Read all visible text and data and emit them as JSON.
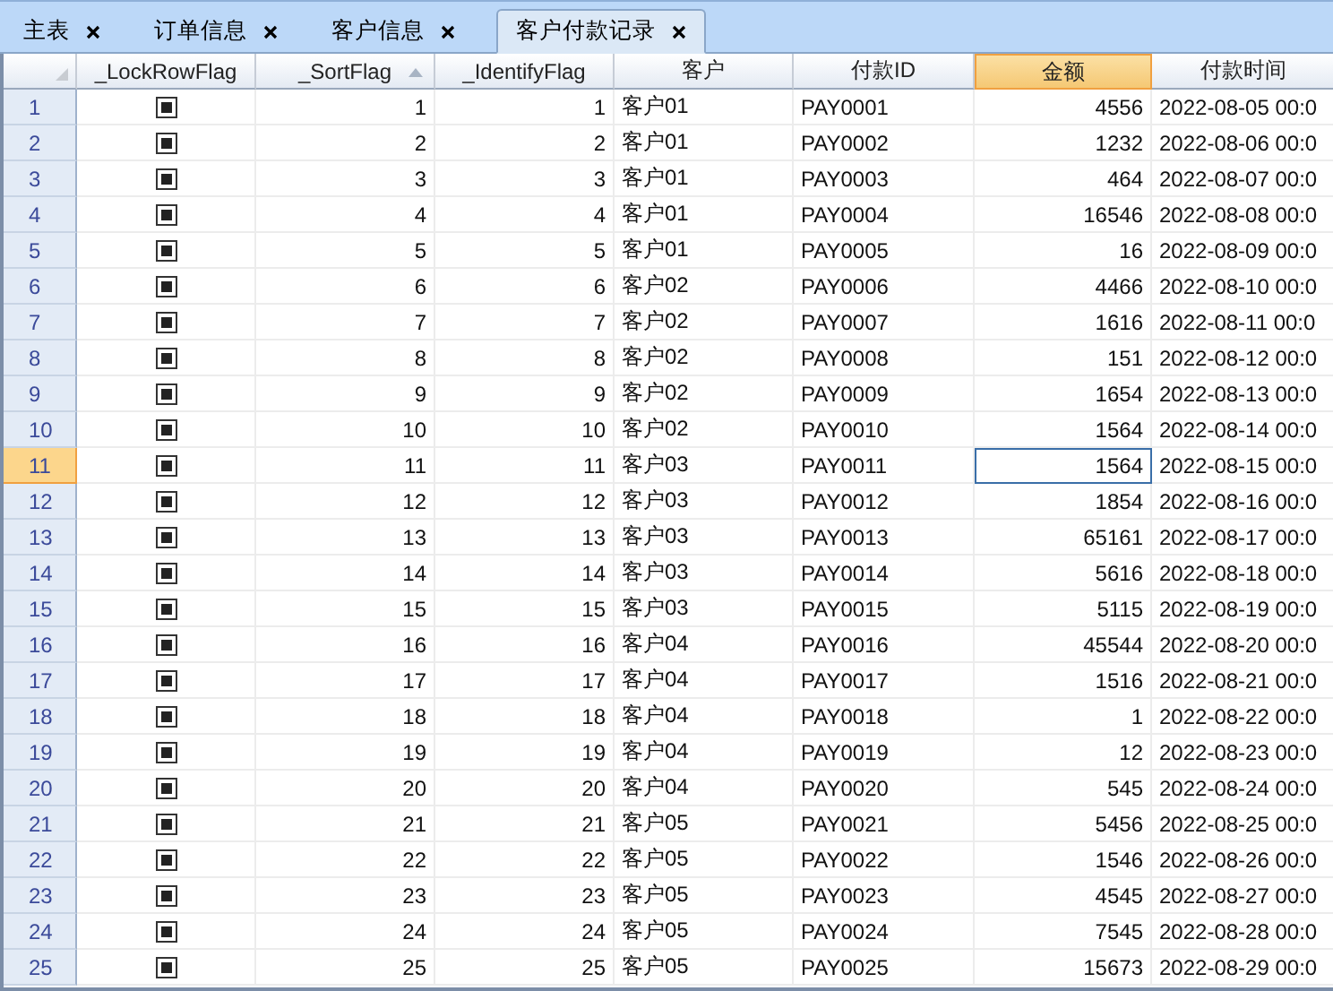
{
  "tabs": [
    {
      "label": "主表",
      "selected": false
    },
    {
      "label": "订单信息",
      "selected": false
    },
    {
      "label": "客户信息",
      "selected": false
    },
    {
      "label": "客户付款记录",
      "selected": true
    }
  ],
  "table": {
    "columns": [
      {
        "label": "_LockRowFlag",
        "sorted": false,
        "selected": false
      },
      {
        "label": "_SortFlag",
        "sorted": true,
        "selected": false
      },
      {
        "label": "_IdentifyFlag",
        "sorted": false,
        "selected": false
      },
      {
        "label": "客户",
        "sorted": false,
        "selected": false
      },
      {
        "label": "付款ID",
        "sorted": false,
        "selected": false
      },
      {
        "label": "金额",
        "sorted": false,
        "selected": true
      },
      {
        "label": "付款时间",
        "sorted": false,
        "selected": false
      }
    ],
    "rows": [
      {
        "num": "1",
        "checked": true,
        "cells": [
          "1",
          "1",
          "客户01",
          "PAY0001",
          "4556",
          "2022-08-05 00:0"
        ],
        "selected": false
      },
      {
        "num": "2",
        "checked": true,
        "cells": [
          "2",
          "2",
          "客户01",
          "PAY0002",
          "1232",
          "2022-08-06 00:0"
        ],
        "selected": false
      },
      {
        "num": "3",
        "checked": true,
        "cells": [
          "3",
          "3",
          "客户01",
          "PAY0003",
          "464",
          "2022-08-07 00:0"
        ],
        "selected": false
      },
      {
        "num": "4",
        "checked": true,
        "cells": [
          "4",
          "4",
          "客户01",
          "PAY0004",
          "16546",
          "2022-08-08 00:0"
        ],
        "selected": false
      },
      {
        "num": "5",
        "checked": true,
        "cells": [
          "5",
          "5",
          "客户01",
          "PAY0005",
          "16",
          "2022-08-09 00:0"
        ],
        "selected": false
      },
      {
        "num": "6",
        "checked": true,
        "cells": [
          "6",
          "6",
          "客户02",
          "PAY0006",
          "4466",
          "2022-08-10 00:0"
        ],
        "selected": false
      },
      {
        "num": "7",
        "checked": true,
        "cells": [
          "7",
          "7",
          "客户02",
          "PAY0007",
          "1616",
          "2022-08-11 00:0"
        ],
        "selected": false
      },
      {
        "num": "8",
        "checked": true,
        "cells": [
          "8",
          "8",
          "客户02",
          "PAY0008",
          "151",
          "2022-08-12 00:0"
        ],
        "selected": false
      },
      {
        "num": "9",
        "checked": true,
        "cells": [
          "9",
          "9",
          "客户02",
          "PAY0009",
          "1654",
          "2022-08-13 00:0"
        ],
        "selected": false
      },
      {
        "num": "10",
        "checked": true,
        "cells": [
          "10",
          "10",
          "客户02",
          "PAY0010",
          "1564",
          "2022-08-14 00:0"
        ],
        "selected": false
      },
      {
        "num": "11",
        "checked": true,
        "cells": [
          "11",
          "11",
          "客户03",
          "PAY0011",
          "1564",
          "2022-08-15 00:0"
        ],
        "selected": true
      },
      {
        "num": "12",
        "checked": true,
        "cells": [
          "12",
          "12",
          "客户03",
          "PAY0012",
          "1854",
          "2022-08-16 00:0"
        ],
        "selected": false
      },
      {
        "num": "13",
        "checked": true,
        "cells": [
          "13",
          "13",
          "客户03",
          "PAY0013",
          "65161",
          "2022-08-17 00:0"
        ],
        "selected": false
      },
      {
        "num": "14",
        "checked": true,
        "cells": [
          "14",
          "14",
          "客户03",
          "PAY0014",
          "5616",
          "2022-08-18 00:0"
        ],
        "selected": false
      },
      {
        "num": "15",
        "checked": true,
        "cells": [
          "15",
          "15",
          "客户03",
          "PAY0015",
          "5115",
          "2022-08-19 00:0"
        ],
        "selected": false
      },
      {
        "num": "16",
        "checked": true,
        "cells": [
          "16",
          "16",
          "客户04",
          "PAY0016",
          "45544",
          "2022-08-20 00:0"
        ],
        "selected": false
      },
      {
        "num": "17",
        "checked": true,
        "cells": [
          "17",
          "17",
          "客户04",
          "PAY0017",
          "1516",
          "2022-08-21 00:0"
        ],
        "selected": false
      },
      {
        "num": "18",
        "checked": true,
        "cells": [
          "18",
          "18",
          "客户04",
          "PAY0018",
          "1",
          "2022-08-22 00:0"
        ],
        "selected": false
      },
      {
        "num": "19",
        "checked": true,
        "cells": [
          "19",
          "19",
          "客户04",
          "PAY0019",
          "12",
          "2022-08-23 00:0"
        ],
        "selected": false
      },
      {
        "num": "20",
        "checked": true,
        "cells": [
          "20",
          "20",
          "客户04",
          "PAY0020",
          "545",
          "2022-08-24 00:0"
        ],
        "selected": false
      },
      {
        "num": "21",
        "checked": true,
        "cells": [
          "21",
          "21",
          "客户05",
          "PAY0021",
          "5456",
          "2022-08-25 00:0"
        ],
        "selected": false
      },
      {
        "num": "22",
        "checked": true,
        "cells": [
          "22",
          "22",
          "客户05",
          "PAY0022",
          "1546",
          "2022-08-26 00:0"
        ],
        "selected": false
      },
      {
        "num": "23",
        "checked": true,
        "cells": [
          "23",
          "23",
          "客户05",
          "PAY0023",
          "4545",
          "2022-08-27 00:0"
        ],
        "selected": false
      },
      {
        "num": "24",
        "checked": true,
        "cells": [
          "24",
          "24",
          "客户05",
          "PAY0024",
          "7545",
          "2022-08-28 00:0"
        ],
        "selected": false
      },
      {
        "num": "25",
        "checked": true,
        "cells": [
          "25",
          "25",
          "客户05",
          "PAY0025",
          "15673",
          "2022-08-29 00:0"
        ],
        "selected": false
      }
    ]
  }
}
